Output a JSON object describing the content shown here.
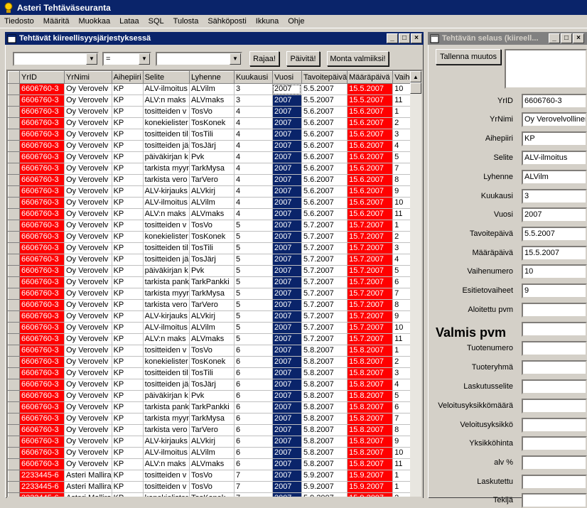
{
  "app": {
    "title": "Asteri Tehtäväseuranta"
  },
  "menu": [
    "Tiedosto",
    "Määritä",
    "Muokkaa",
    "Lataa",
    "SQL",
    "Tulosta",
    "Sähköposti",
    "Ikkuna",
    "Ohje"
  ],
  "left_window": {
    "title": "Tehtävät kiireellisyysjärjestyksessä",
    "filter_field": "",
    "filter_operator": "=",
    "filter_value": "",
    "buttons": {
      "rajaa": "Rajaa!",
      "paivita": "Päivitä!",
      "monta": "Monta valmiiksi!"
    },
    "columns": [
      "YrID",
      "YrNimi",
      "Aihepiiri",
      "Selite",
      "Lyhenne",
      "Kuukausi",
      "Vuosi",
      "Tavoitepäivä",
      "Määräpäivä",
      "Vaihe"
    ],
    "rows": [
      [
        "6606760-3",
        "Oy Verovelv",
        "KP",
        "ALV-ilmoitus",
        "ALVilm",
        "3",
        "2007",
        "5.5.2007",
        "15.5.2007",
        "10"
      ],
      [
        "6606760-3",
        "Oy Verovelv",
        "KP",
        "ALV:n maks",
        "ALVmaks",
        "3",
        "2007",
        "5.5.2007",
        "15.5.2007",
        "11"
      ],
      [
        "6606760-3",
        "Oy Verovelv",
        "KP",
        "tositteiden v",
        "TosVo",
        "4",
        "2007",
        "5.6.2007",
        "15.6.2007",
        "1"
      ],
      [
        "6606760-3",
        "Oy Verovelv",
        "KP",
        "konekielister",
        "TosKonek",
        "4",
        "2007",
        "5.6.2007",
        "15.6.2007",
        "2"
      ],
      [
        "6606760-3",
        "Oy Verovelv",
        "KP",
        "tositteiden til",
        "TosTili",
        "4",
        "2007",
        "5.6.2007",
        "15.6.2007",
        "3"
      ],
      [
        "6606760-3",
        "Oy Verovelv",
        "KP",
        "tositteiden jä",
        "TosJärj",
        "4",
        "2007",
        "5.6.2007",
        "15.6.2007",
        "4"
      ],
      [
        "6606760-3",
        "Oy Verovelv",
        "KP",
        "päiväkirjan k",
        "Pvk",
        "4",
        "2007",
        "5.6.2007",
        "15.6.2007",
        "5"
      ],
      [
        "6606760-3",
        "Oy Verovelv",
        "KP",
        "tarkista myyr",
        "TarkMysa",
        "4",
        "2007",
        "5.6.2007",
        "15.6.2007",
        "7"
      ],
      [
        "6606760-3",
        "Oy Verovelv",
        "KP",
        "tarkista vero",
        "TarVero",
        "4",
        "2007",
        "5.6.2007",
        "15.6.2007",
        "8"
      ],
      [
        "6606760-3",
        "Oy Verovelv",
        "KP",
        "ALV-kirjauks",
        "ALVkirj",
        "4",
        "2007",
        "5.6.2007",
        "15.6.2007",
        "9"
      ],
      [
        "6606760-3",
        "Oy Verovelv",
        "KP",
        "ALV-ilmoitus",
        "ALVilm",
        "4",
        "2007",
        "5.6.2007",
        "15.6.2007",
        "10"
      ],
      [
        "6606760-3",
        "Oy Verovelv",
        "KP",
        "ALV:n maks",
        "ALVmaks",
        "4",
        "2007",
        "5.6.2007",
        "15.6.2007",
        "11"
      ],
      [
        "6606760-3",
        "Oy Verovelv",
        "KP",
        "tositteiden v",
        "TosVo",
        "5",
        "2007",
        "5.7.2007",
        "15.7.2007",
        "1"
      ],
      [
        "6606760-3",
        "Oy Verovelv",
        "KP",
        "konekielister",
        "TosKonek",
        "5",
        "2007",
        "5.7.2007",
        "15.7.2007",
        "2"
      ],
      [
        "6606760-3",
        "Oy Verovelv",
        "KP",
        "tositteiden til",
        "TosTili",
        "5",
        "2007",
        "5.7.2007",
        "15.7.2007",
        "3"
      ],
      [
        "6606760-3",
        "Oy Verovelv",
        "KP",
        "tositteiden jä",
        "TosJärj",
        "5",
        "2007",
        "5.7.2007",
        "15.7.2007",
        "4"
      ],
      [
        "6606760-3",
        "Oy Verovelv",
        "KP",
        "päiväkirjan k",
        "Pvk",
        "5",
        "2007",
        "5.7.2007",
        "15.7.2007",
        "5"
      ],
      [
        "6606760-3",
        "Oy Verovelv",
        "KP",
        "tarkista pank",
        "TarkPankki",
        "5",
        "2007",
        "5.7.2007",
        "15.7.2007",
        "6"
      ],
      [
        "6606760-3",
        "Oy Verovelv",
        "KP",
        "tarkista myyr",
        "TarkMysa",
        "5",
        "2007",
        "5.7.2007",
        "15.7.2007",
        "7"
      ],
      [
        "6606760-3",
        "Oy Verovelv",
        "KP",
        "tarkista vero",
        "TarVero",
        "5",
        "2007",
        "5.7.2007",
        "15.7.2007",
        "8"
      ],
      [
        "6606760-3",
        "Oy Verovelv",
        "KP",
        "ALV-kirjauks",
        "ALVkirj",
        "5",
        "2007",
        "5.7.2007",
        "15.7.2007",
        "9"
      ],
      [
        "6606760-3",
        "Oy Verovelv",
        "KP",
        "ALV-ilmoitus",
        "ALVilm",
        "5",
        "2007",
        "5.7.2007",
        "15.7.2007",
        "10"
      ],
      [
        "6606760-3",
        "Oy Verovelv",
        "KP",
        "ALV:n maks",
        "ALVmaks",
        "5",
        "2007",
        "5.7.2007",
        "15.7.2007",
        "11"
      ],
      [
        "6606760-3",
        "Oy Verovelv",
        "KP",
        "tositteiden v",
        "TosVo",
        "6",
        "2007",
        "5.8.2007",
        "15.8.2007",
        "1"
      ],
      [
        "6606760-3",
        "Oy Verovelv",
        "KP",
        "konekielister",
        "TosKonek",
        "6",
        "2007",
        "5.8.2007",
        "15.8.2007",
        "2"
      ],
      [
        "6606760-3",
        "Oy Verovelv",
        "KP",
        "tositteiden til",
        "TosTili",
        "6",
        "2007",
        "5.8.2007",
        "15.8.2007",
        "3"
      ],
      [
        "6606760-3",
        "Oy Verovelv",
        "KP",
        "tositteiden jä",
        "TosJärj",
        "6",
        "2007",
        "5.8.2007",
        "15.8.2007",
        "4"
      ],
      [
        "6606760-3",
        "Oy Verovelv",
        "KP",
        "päiväkirjan k",
        "Pvk",
        "6",
        "2007",
        "5.8.2007",
        "15.8.2007",
        "5"
      ],
      [
        "6606760-3",
        "Oy Verovelv",
        "KP",
        "tarkista pank",
        "TarkPankki",
        "6",
        "2007",
        "5.8.2007",
        "15.8.2007",
        "6"
      ],
      [
        "6606760-3",
        "Oy Verovelv",
        "KP",
        "tarkista myyr",
        "TarkMysa",
        "6",
        "2007",
        "5.8.2007",
        "15.8.2007",
        "7"
      ],
      [
        "6606760-3",
        "Oy Verovelv",
        "KP",
        "tarkista vero",
        "TarVero",
        "6",
        "2007",
        "5.8.2007",
        "15.8.2007",
        "8"
      ],
      [
        "6606760-3",
        "Oy Verovelv",
        "KP",
        "ALV-kirjauks",
        "ALVkirj",
        "6",
        "2007",
        "5.8.2007",
        "15.8.2007",
        "9"
      ],
      [
        "6606760-3",
        "Oy Verovelv",
        "KP",
        "ALV-ilmoitus",
        "ALVilm",
        "6",
        "2007",
        "5.8.2007",
        "15.8.2007",
        "10"
      ],
      [
        "6606760-3",
        "Oy Verovelv",
        "KP",
        "ALV:n maks",
        "ALVmaks",
        "6",
        "2007",
        "5.8.2007",
        "15.8.2007",
        "11"
      ],
      [
        "2233445-6",
        "Asteri Mallira",
        "KP",
        "tositteiden v",
        "TosVo",
        "7",
        "2007",
        "5.9.2007",
        "15.9.2007",
        "1"
      ],
      [
        "2233445-6",
        "Asteri Mallira",
        "KP",
        "tositteiden v",
        "TosVo",
        "7",
        "2007",
        "5.9.2007",
        "15.9.2007",
        "1"
      ],
      [
        "2233445-6",
        "Asteri Mallira",
        "KP",
        "konekielister",
        "TosKonek",
        "7",
        "2007",
        "5.9.2007",
        "15.9.2007",
        "2"
      ]
    ]
  },
  "right_window": {
    "title": "Tehtävän selaus (kiireell...",
    "save_button": "Tallenna muutos",
    "big_label": "Valmis pvm",
    "fields": [
      {
        "label": "YrID",
        "value": "6606760-3"
      },
      {
        "label": "YrNimi",
        "value": "Oy Verovelvolliner"
      },
      {
        "label": "Aihepiiri",
        "value": "KP"
      },
      {
        "label": "Selite",
        "value": "ALV-ilmoitus"
      },
      {
        "label": "Lyhenne",
        "value": "ALVilm"
      },
      {
        "label": "Kuukausi",
        "value": "3"
      },
      {
        "label": "Vuosi",
        "value": "2007"
      },
      {
        "label": "Tavoitepäivä",
        "value": "5.5.2007"
      },
      {
        "label": "Määräpäivä",
        "value": "15.5.2007"
      },
      {
        "label": "Vaihenumero",
        "value": "10"
      },
      {
        "label": "Esitietovaiheet",
        "value": "9"
      },
      {
        "label": "Aloitettu pvm",
        "value": ""
      },
      {
        "label": "",
        "value": ""
      },
      {
        "label": "Tuotenumero",
        "value": ""
      },
      {
        "label": "Tuoteryhmä",
        "value": ""
      },
      {
        "label": "Laskutusselite",
        "value": ""
      },
      {
        "label": "Veloitusyksikkömäärä",
        "value": ""
      },
      {
        "label": "Veloitusyksikkö",
        "value": ""
      },
      {
        "label": "Yksikköhinta",
        "value": ""
      },
      {
        "label": "alv %",
        "value": ""
      },
      {
        "label": "Laskutettu",
        "value": ""
      },
      {
        "label": "Tekijä",
        "value": ""
      }
    ]
  },
  "colors": {
    "title_active": "#0a246a",
    "title_inactive": "#808080",
    "deadline": "#ff0000",
    "year": "#0a246a"
  }
}
